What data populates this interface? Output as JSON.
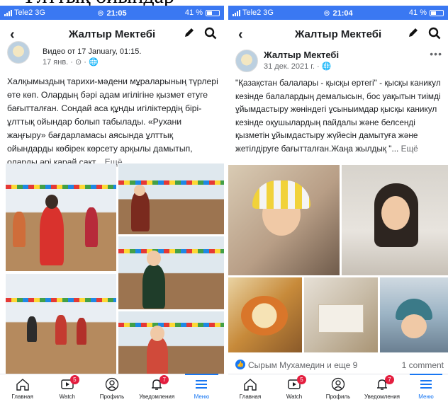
{
  "left": {
    "status": {
      "carrier": "Tele2",
      "network": "3G",
      "time": "21:05",
      "battery": "41 %",
      "battery_level": 0.41
    },
    "nav": {
      "title": "Жалтыр Мектебі"
    },
    "post": {
      "meta_partial": "Видео от 17 January, 01:15.",
      "date": "17 янв. · ⊙ · 🌐",
      "text": "Халқымыздың тарихи-мәдени мұраларының түрлері өте көп. Олардың бәрі адам игілігіне қызмет етуге бағытталған. Сондай аса құнды игіліктердің бірі- ұлттық ойындар болып табылады. «Рухани жаңғыру» бағдарламасы аясында  ұлттық ойындарды көбірек көрсету арқылы дамытып,  оларды әрі қарай сақт... ",
      "more": "Ещё"
    },
    "tabs": [
      {
        "label": "Главная",
        "icon": "home-icon"
      },
      {
        "label": "Watch",
        "icon": "watch-icon",
        "badge": "5"
      },
      {
        "label": "Профиль",
        "icon": "profile-icon"
      },
      {
        "label": "Уведомления",
        "icon": "bell-icon",
        "badge": "7"
      },
      {
        "label": "Меню",
        "icon": "menu-icon",
        "active": true
      }
    ]
  },
  "right": {
    "status": {
      "carrier": "Tele2",
      "network": "3G",
      "time": "21:04",
      "battery": "41 %",
      "battery_level": 0.41
    },
    "nav": {
      "title": "Жалтыр Мектебі"
    },
    "post": {
      "author": "Жалтыр Мектебі",
      "date": "31 дек. 2021 г. · 🌐",
      "text": "\"Қазақстан балалары - қысқы ертегі\" - қысқы каникул кезінде балалардың демалысын, бос уақытын тиімді ұйымдастыру жөніндегі ұсыныимдар  қысқы каникул кезінде оқушылардың пайдалы және белсенді қызметін ұйымдастыру жүйесін дамытуға және жетілдіруге бағытталған.Жаңа жылдық  \"... ",
      "more": "Ещё"
    },
    "reactions": {
      "names": "Сырым Мухамедин и еще 9",
      "comments": "1 comment"
    },
    "tabs": [
      {
        "label": "Главная",
        "icon": "home-icon"
      },
      {
        "label": "Watch",
        "icon": "watch-icon",
        "badge": "5"
      },
      {
        "label": "Профиль",
        "icon": "profile-icon"
      },
      {
        "label": "Уведомления",
        "icon": "bell-icon",
        "badge": "7"
      },
      {
        "label": "Меню",
        "icon": "menu-icon",
        "active": true
      }
    ]
  },
  "colors": {
    "status_bar": "#3a78f2",
    "accent": "#1877f2",
    "badge": "#e41e3f"
  }
}
